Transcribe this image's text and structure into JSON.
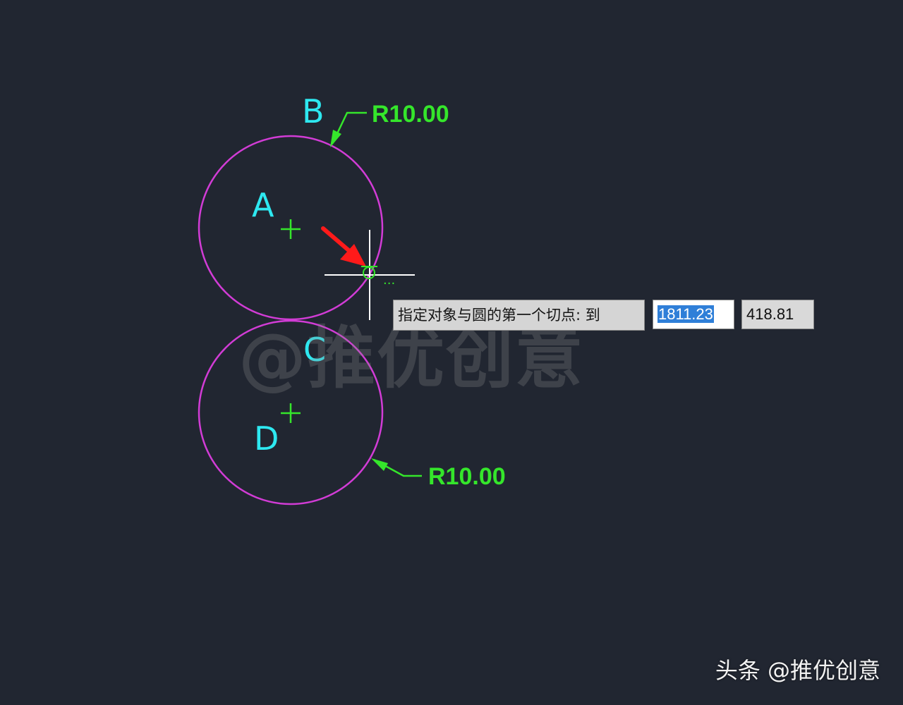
{
  "canvas": {
    "background": "#212631"
  },
  "colors": {
    "circle": "#d23cd6",
    "label": "#2ee8f0",
    "dimension": "#35e62b",
    "crosshair": "#ffffff",
    "pointer_arrow": "#ff1a1a"
  },
  "labels": {
    "a": "A",
    "b": "B",
    "c": "C",
    "d": "D"
  },
  "dimensions": {
    "top_radius": "R10.00",
    "bottom_radius": "R10.00"
  },
  "snap": {
    "marker_icon": "tangent-snap-icon",
    "ellipsis": "..."
  },
  "command_prompt": {
    "text": "指定对象与圆的第一个切点: 到",
    "x_value": "1811.23",
    "y_value": "418.81"
  },
  "watermark": {
    "center": "@推优创意",
    "corner": "头条 @推优创意"
  }
}
